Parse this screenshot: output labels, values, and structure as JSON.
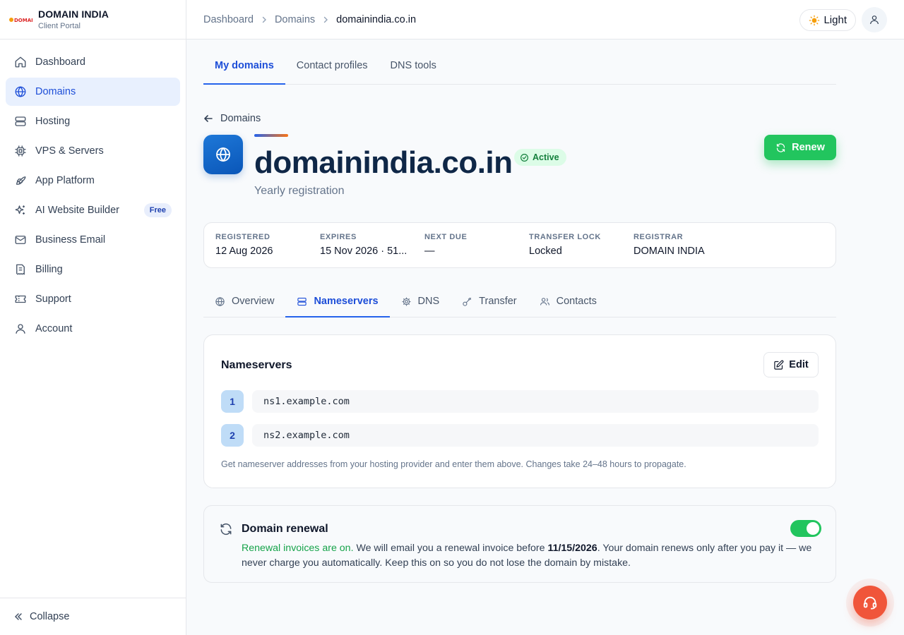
{
  "brand": {
    "name": "DOMAIN INDIA",
    "subtitle": "Client Portal",
    "logo_text": "DOMAIN INDIA",
    "logo_icon": "domain-india-logo"
  },
  "sidebar": {
    "items": [
      {
        "label": "Dashboard",
        "icon": "home-icon"
      },
      {
        "label": "Domains",
        "icon": "globe-icon",
        "active": true
      },
      {
        "label": "Hosting",
        "icon": "server-icon"
      },
      {
        "label": "VPS & Servers",
        "icon": "cpu-icon"
      },
      {
        "label": "App Platform",
        "icon": "rocket-icon"
      },
      {
        "label": "AI Website Builder",
        "icon": "sparkles-icon",
        "badge": "Free"
      },
      {
        "label": "Business Email",
        "icon": "mail-icon"
      },
      {
        "label": "Billing",
        "icon": "receipt-icon"
      },
      {
        "label": "Support",
        "icon": "ticket-icon"
      },
      {
        "label": "Account",
        "icon": "user-icon"
      }
    ],
    "collapse_label": "Collapse"
  },
  "topbar": {
    "breadcrumbs": [
      "Dashboard",
      "Domains",
      "domainindia.co.in"
    ],
    "theme_label": "Light",
    "theme_icon": "sun-icon",
    "user_icon": "user-icon"
  },
  "top_tabs": [
    {
      "label": "My domains",
      "active": true
    },
    {
      "label": "Contact profiles"
    },
    {
      "label": "DNS tools"
    }
  ],
  "back_label": "Domains",
  "domain": {
    "name": "domainindia.co.in",
    "status": "Active",
    "subtitle": "Yearly registration",
    "renew_label": "Renew"
  },
  "facts": [
    {
      "label": "REGISTERED",
      "value": "12 Aug 2026"
    },
    {
      "label": "EXPIRES",
      "value": "15 Nov 2026 · 51..."
    },
    {
      "label": "NEXT DUE",
      "value": "—"
    },
    {
      "label": "TRANSFER LOCK",
      "value": "Locked"
    },
    {
      "label": "REGISTRAR",
      "value": "DOMAIN INDIA"
    }
  ],
  "sub_tabs": [
    {
      "label": "Overview",
      "icon": "globe-icon"
    },
    {
      "label": "Nameservers",
      "icon": "server-icon",
      "active": true
    },
    {
      "label": "DNS",
      "icon": "gear-icon"
    },
    {
      "label": "Transfer",
      "icon": "key-icon"
    },
    {
      "label": "Contacts",
      "icon": "users-icon"
    }
  ],
  "nameservers": {
    "title": "Nameservers",
    "edit_label": "Edit",
    "entries": [
      {
        "num": "1",
        "value": "ns1.example.com"
      },
      {
        "num": "2",
        "value": "ns2.example.com"
      }
    ],
    "help": "Get nameserver addresses from your hosting provider and enter them above. Changes take 24–48 hours to propagate."
  },
  "renewal": {
    "title": "Domain renewal",
    "enabled": true,
    "status_text": "Renewal invoices are on.",
    "text_before_date": " We will email you a renewal invoice before ",
    "date": "11/15/2026",
    "text_after_date": ". Your domain renews only after you pay it — we never charge you automatically. Keep this on so you do not lose the domain by mistake."
  },
  "colors": {
    "accent": "#2563eb",
    "success": "#22c55e",
    "fab": "#f0553a"
  }
}
